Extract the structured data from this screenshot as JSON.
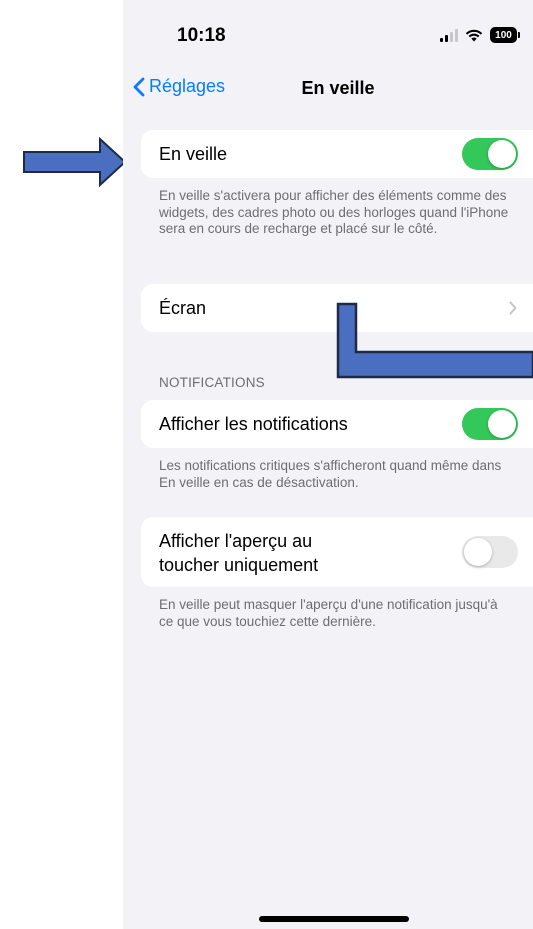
{
  "status_bar": {
    "time": "10:18",
    "battery": "100"
  },
  "nav": {
    "back_label": "Réglages",
    "title": "En veille"
  },
  "standby_group": {
    "label": "En veille",
    "toggle_on": true,
    "footer": "En veille s'activera pour afficher des éléments comme des widgets, des cadres photo ou des horloges quand l'iPhone sera en cours de recharge et placé sur le côté."
  },
  "display_row": {
    "label": "Écran"
  },
  "notifications": {
    "header": "NOTIFICATIONS",
    "show_label": "Afficher les notifications",
    "show_toggle_on": true,
    "show_footer": "Les notifications critiques s'afficheront quand même dans En veille en cas de désactivation.",
    "preview_label_line1": "Afficher l'aperçu au",
    "preview_label_line2": "toucher uniquement",
    "preview_toggle_on": false,
    "preview_footer": "En veille peut masquer l'aperçu d'une notification jusqu'à ce que vous touchiez cette dernière."
  },
  "colors": {
    "accent": "#0a7aff",
    "toggle_on": "#34c759",
    "annotation": "#4a6fc0"
  }
}
